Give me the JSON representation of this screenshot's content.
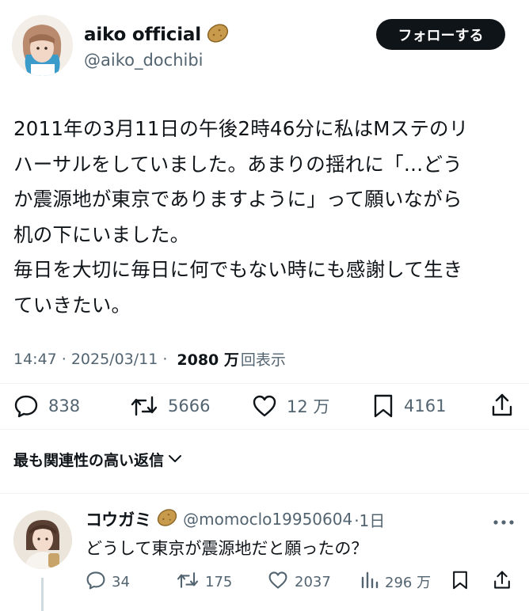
{
  "tweet": {
    "author": {
      "display_name": "aiko official",
      "handle": "@aiko_dochibi",
      "avatar_icon": "avatar",
      "badge_icon": "potato-emoji-icon"
    },
    "follow_label": "フォローする",
    "text_lines": [
      "2011年の3月11日の午後2時46分に私はMステのリ",
      "ハーサルをしていました。あまりの揺れに「…どう",
      "か震源地が東京でありますように」って願いながら",
      "机の下にいました。",
      "毎日を大切に毎日に何でもない時にも感謝して生き",
      "ていきたい。"
    ],
    "time": "14:47",
    "date": "2025/03/11",
    "separator": "·",
    "views_count": "2080 万",
    "views_label": "回表示",
    "actions": {
      "replies": "838",
      "retweets": "5666",
      "likes": "12 万",
      "bookmarks": "4161"
    }
  },
  "related_label": "最も関連性の高い返信",
  "reply": {
    "display_name": "コウガミ",
    "badge_icon": "potato-emoji-icon",
    "handle": "@momoclo19950604",
    "time": "·1日",
    "text": "どうして東京が震源地だと願ったの？",
    "actions": {
      "replies": "34",
      "retweets": "175",
      "likes": "2037",
      "views": "296 万"
    }
  },
  "colors": {
    "text_primary": "#0f1419",
    "text_secondary": "#536471",
    "follow_bg": "#0f1419",
    "divider": "#eff3f4"
  }
}
